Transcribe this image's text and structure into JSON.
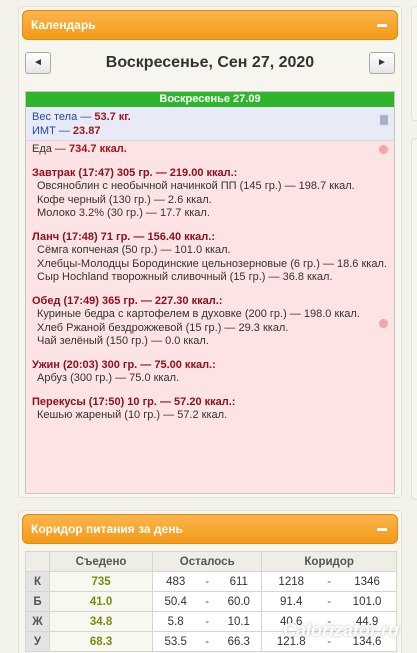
{
  "calendar": {
    "title": "Календарь",
    "prev": "◄",
    "next": "►",
    "date_title": "Воскресенье, Сен 27, 2020",
    "day_header": "Воскресенье 27.09",
    "weight_label": "Вес тела — ",
    "weight_value": "53.7 кг.",
    "bmi_label": "ИМТ — ",
    "bmi_value": "23.87",
    "food_label": "Еда — ",
    "food_value": "734.7 ккал.",
    "meals": [
      {
        "header": "Завтрак (17:47) 305 гр. — 219.00 ккал.:",
        "items": [
          "Овсяноблин с необычной начинкой ПП (145 гр.) — 198.7 ккал.",
          "Кофе черный (130 гр.) — 2.6 ккал.",
          "Молоко 3.2% (30 гр.) — 17.7 ккал."
        ]
      },
      {
        "header": "Ланч (17:48) 71 гр. — 156.40 ккал.:",
        "items": [
          "Сёмга копченая (50 гр.) — 101.0 ккал.",
          "Хлебцы-Молодцы Бородинские цельнозерновые (6 гр.) — 18.6 ккал.",
          "Сыр Hochland творожный сливочный (15 гр.) — 36.8 ккал."
        ]
      },
      {
        "header": "Обед (17:49) 365 гр. — 227.30 ккал.:",
        "items": [
          "Куриные бедра с картофелем в духовке (200 гр.) — 198.0 ккал.",
          "Хлеб Ржаной бездрожжевой (15 гр.) — 29.3 ккал.",
          "Чай зелёный (150 гр.) — 0.0 ккал."
        ]
      },
      {
        "header": "Ужин (20:03) 300 гр. — 75.00 ккал.:",
        "items": [
          "Арбуз (300 гр.) — 75.0 ккал."
        ]
      },
      {
        "header": "Перекусы (17:50) 10 гр. — 57.20 ккал.:",
        "items": [
          "Кешью жареный (10 гр.) — 57.2 ккал."
        ]
      }
    ]
  },
  "corridor": {
    "title": "Коридор питания за день",
    "headers": [
      "Съедено",
      "Осталось",
      "Коридор"
    ],
    "rows": [
      {
        "label": "К",
        "eaten": "735",
        "rem_a": "483",
        "rem_b": "611",
        "cor_a": "1218",
        "cor_b": "1346"
      },
      {
        "label": "Б",
        "eaten": "41.0",
        "rem_a": "50.4",
        "rem_b": "60.0",
        "cor_a": "91.4",
        "cor_b": "101.0"
      },
      {
        "label": "Ж",
        "eaten": "34.8",
        "rem_a": "5.8",
        "rem_b": "10.1",
        "cor_a": "40.6",
        "cor_b": "44.9"
      },
      {
        "label": "У",
        "eaten": "68.3",
        "rem_a": "53.5",
        "rem_b": "66.3",
        "cor_a": "121.8",
        "cor_b": "134.6"
      }
    ],
    "dash": "-"
  },
  "watermark": "Calorizator.ru"
}
